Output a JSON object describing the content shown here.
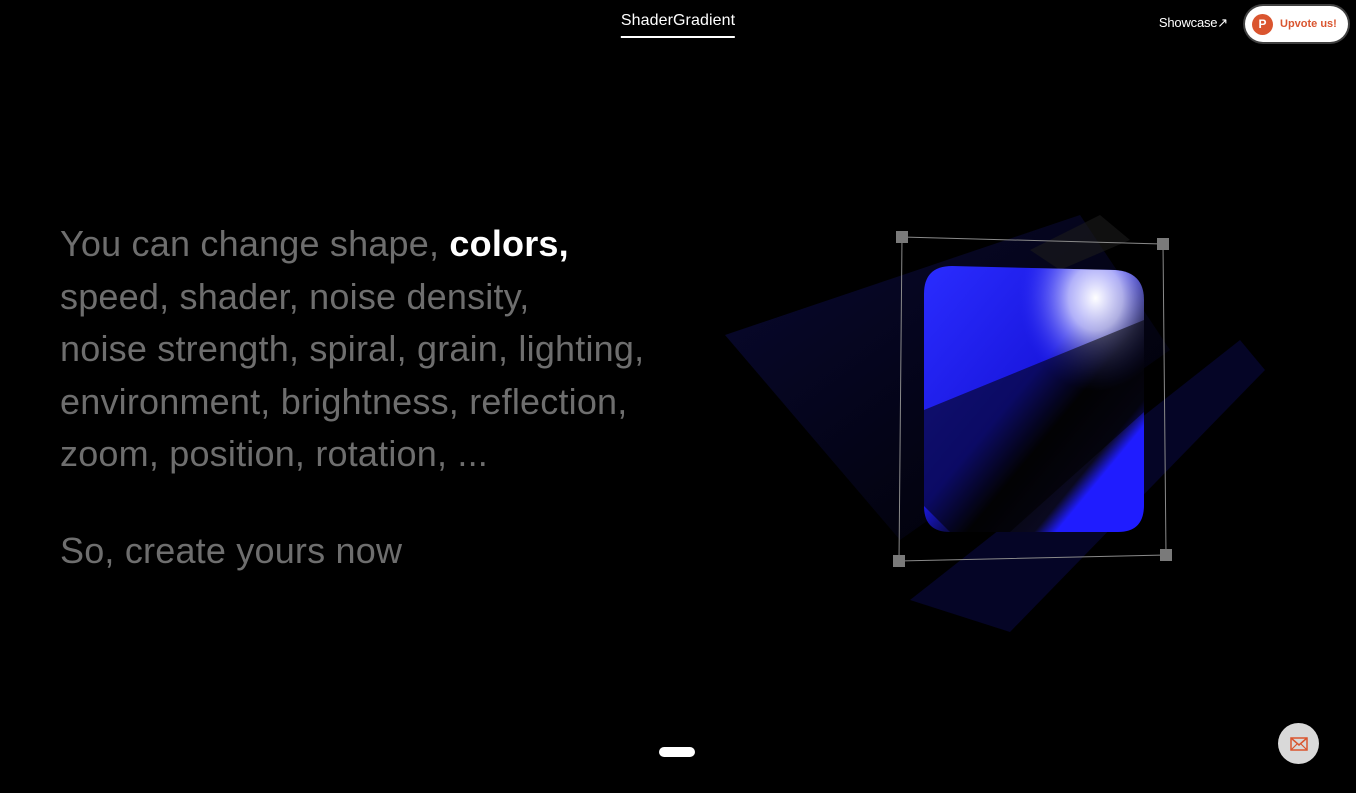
{
  "header": {
    "brand": "ShaderGradient",
    "showcase_label": "Showcase↗",
    "upvote_logo": "P",
    "upvote_label": "Upvote us!"
  },
  "copy": {
    "line1_pre": "You can change shape, ",
    "line1_highlight": "colors,",
    "line2": "speed, shader, noise density,",
    "line3": "noise strength, spiral, grain, lighting,",
    "line4": "environment, brightness, reflection,",
    "line5": "zoom, position, rotation, ...",
    "cta": "So, create yours now"
  },
  "icons": {
    "upvote": "product-hunt-icon",
    "mail": "mail-icon"
  },
  "colors": {
    "background": "#000000",
    "accent_blue": "#1f1cff",
    "product_hunt": "#da552f",
    "muted_text": "#6e6e6e"
  },
  "pager": {
    "active_index": 0
  }
}
